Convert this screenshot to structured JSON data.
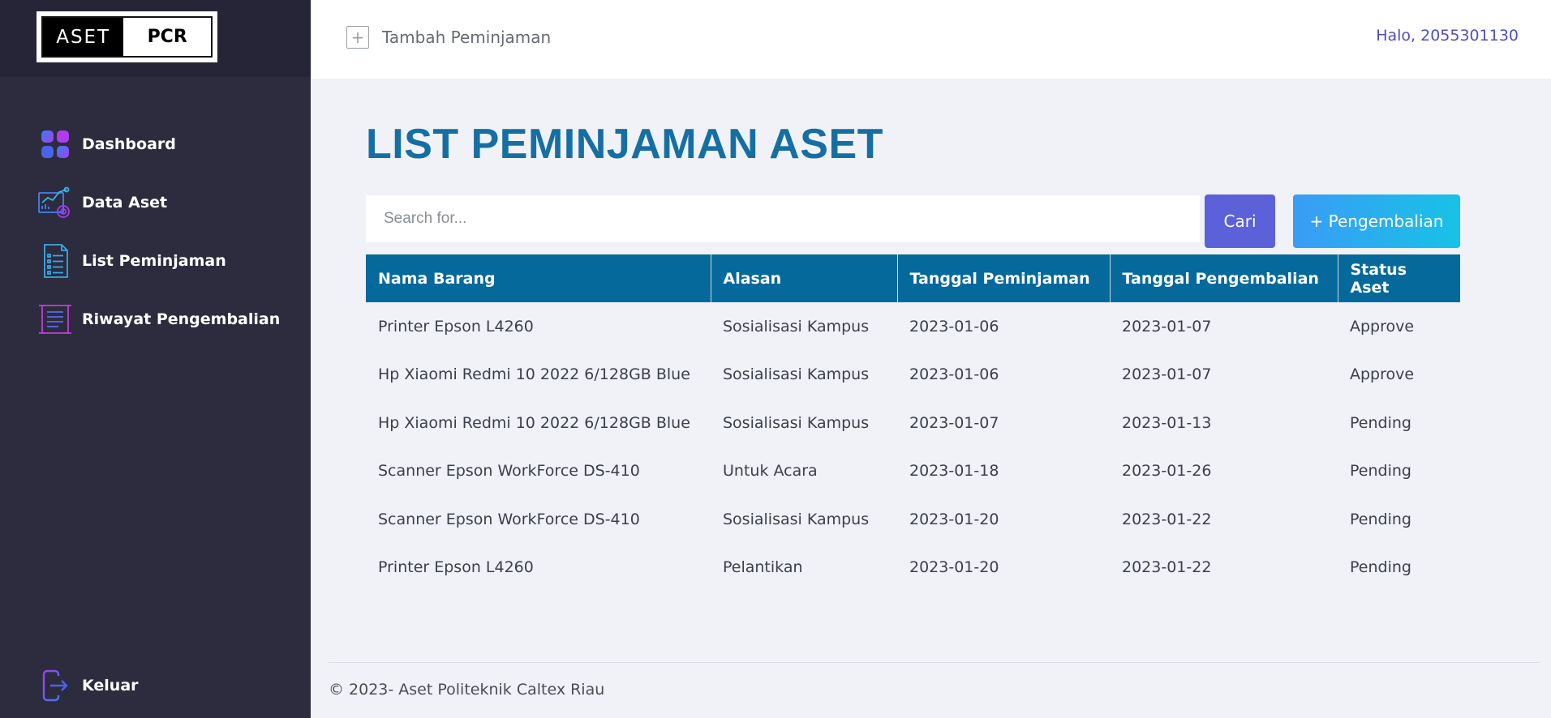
{
  "brand": {
    "left": "ASET",
    "right": "PCR"
  },
  "sidebar": {
    "items": [
      {
        "label": "Dashboard",
        "icon": "dashboard-grid-icon"
      },
      {
        "label": "Data Aset",
        "icon": "data-chart-icon"
      },
      {
        "label": "List Peminjaman",
        "icon": "document-list-icon"
      },
      {
        "label": "Riwayat Pengembalian",
        "icon": "scroll-history-icon"
      }
    ],
    "logout": {
      "label": "Keluar",
      "icon": "logout-icon"
    }
  },
  "topbar": {
    "add_label": "Tambah Peminjaman",
    "add_icon": "plus-square-icon",
    "greeting": "Halo, 2055301130"
  },
  "main": {
    "title": "LIST PEMINJAMAN ASET",
    "search": {
      "placeholder": "Search for...",
      "value": ""
    },
    "search_button": "Cari",
    "return_button": "+ Pengembalian"
  },
  "table": {
    "headers": [
      "Nama Barang",
      "Alasan",
      "Tanggal Peminjaman",
      "Tanggal Pengembalian",
      "Status Aset"
    ],
    "rows": [
      [
        "Printer Epson L4260",
        "Sosialisasi Kampus",
        "2023-01-06",
        "2023-01-07",
        "Approve"
      ],
      [
        "Hp Xiaomi Redmi 10 2022 6/128GB Blue",
        "Sosialisasi Kampus",
        "2023-01-06",
        "2023-01-07",
        "Approve"
      ],
      [
        "Hp Xiaomi Redmi 10 2022 6/128GB Blue",
        "Sosialisasi Kampus",
        "2023-01-07",
        "2023-01-13",
        "Pending"
      ],
      [
        "Scanner Epson WorkForce DS-410",
        "Untuk Acara",
        "2023-01-18",
        "2023-01-26",
        "Pending"
      ],
      [
        "Scanner Epson WorkForce DS-410",
        "Sosialisasi Kampus",
        "2023-01-20",
        "2023-01-22",
        "Pending"
      ],
      [
        "Printer Epson L4260",
        "Pelantikan",
        "2023-01-20",
        "2023-01-22",
        "Pending"
      ]
    ]
  },
  "footer": {
    "text": "© 2023- Aset Politeknik Caltex Riau"
  },
  "colors": {
    "sidebar_bg": "#2c2c3e",
    "title": "#166fa2",
    "table_header": "#06699b",
    "cari_button": "#5b61d9",
    "greeting": "#4e4ec8"
  }
}
